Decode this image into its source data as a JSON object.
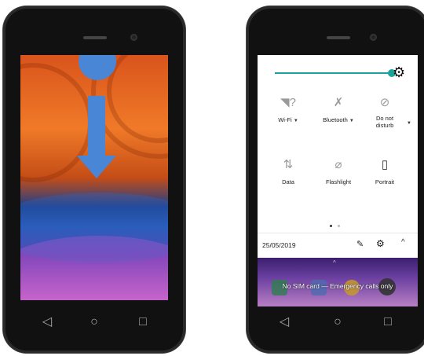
{
  "quick_settings": {
    "tiles": [
      {
        "label": "Wi-Fi",
        "icon": "wifi-question-icon",
        "has_dropdown": true
      },
      {
        "label": "Bluetooth",
        "icon": "bluetooth-off-icon",
        "has_dropdown": true
      },
      {
        "label": "Do not disturb",
        "label_line1": "Do not",
        "label_line2": "disturb",
        "icon": "do-not-disturb-icon",
        "has_dropdown": true
      },
      {
        "label": "Data",
        "icon": "data-off-icon",
        "has_dropdown": false
      },
      {
        "label": "Flashlight",
        "icon": "flashlight-off-icon",
        "has_dropdown": false
      },
      {
        "label": "Portrait",
        "icon": "portrait-icon",
        "has_dropdown": false
      }
    ],
    "date": "25/05/2019",
    "status_message": "No SIM card — Emergency calls only",
    "brightness_level": 1.0
  },
  "colors": {
    "accent": "#1aa39a",
    "gesture_circle": "#4a86d6",
    "gesture_arrow": "#4a86d6",
    "shade_bg": "#ffffff",
    "statusbar_bg": "#3b1f6e"
  },
  "navigation": {
    "back": "◁",
    "home": "○",
    "recents": "□"
  }
}
